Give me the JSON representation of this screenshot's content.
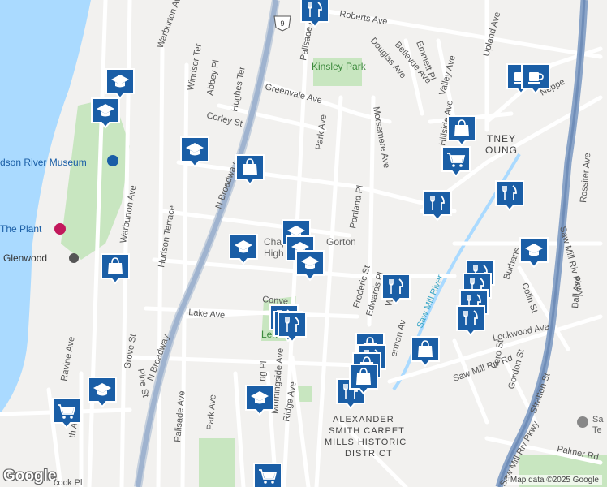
{
  "map": {
    "colors": {
      "water": "#aadaff",
      "land": "#f2f1ef",
      "park": "#c8e6c0",
      "highway": "#8aa4c8",
      "road": "#ffffff",
      "label": "#555555",
      "pin": "#1a5ea6",
      "park_label": "#3d8a3d",
      "river": "#aadaff"
    },
    "street_labels": [
      {
        "text": "Warburton Ave"
      },
      {
        "text": "Roberts Ave"
      },
      {
        "text": "Palisade Ave"
      },
      {
        "text": "Kinsley Park"
      },
      {
        "text": "Douglas Ave"
      },
      {
        "text": "Bellevue Ave"
      },
      {
        "text": "Emmett Pl"
      },
      {
        "text": "Valley Ave"
      },
      {
        "text": "Upland Ave"
      },
      {
        "text": "Windsor Ter"
      },
      {
        "text": "Abbey Pl"
      },
      {
        "text": "Hughes Ter"
      },
      {
        "text": "Greenvale Ave"
      },
      {
        "text": "Corley St"
      },
      {
        "text": "Park Ave"
      },
      {
        "text": "Morsemere Ave"
      },
      {
        "text": "Hillside Ave"
      },
      {
        "text": "Neppe"
      },
      {
        "text": "dson River Museum"
      },
      {
        "text": "N Broadway"
      },
      {
        "text": "Warburton Ave"
      },
      {
        "text": "Hudson Terrace"
      },
      {
        "text": "Portland Pl"
      },
      {
        "text": "The Plant"
      },
      {
        "text": "Glenwood"
      },
      {
        "text": "Chapel"
      },
      {
        "text": "Gorton"
      },
      {
        "text": "High"
      },
      {
        "text": "Frederic St"
      },
      {
        "text": "Saw Mill Riv Pkwy"
      },
      {
        "text": "Rossiter Ave"
      },
      {
        "text": "Burhans"
      },
      {
        "text": "Colin St"
      },
      {
        "text": "Ball Ave"
      },
      {
        "text": "Conve"
      },
      {
        "text": "Lake Ave"
      },
      {
        "text": "Lennon"
      },
      {
        "text": "Edwards Pl"
      },
      {
        "text": "Wood"
      },
      {
        "text": "Saw Mill River"
      },
      {
        "text": "Lockwood Ave"
      },
      {
        "text": "Ravine Ave"
      },
      {
        "text": "Grove St"
      },
      {
        "text": "Pine St"
      },
      {
        "text": "N Broadway"
      },
      {
        "text": "Palisade Ave"
      },
      {
        "text": "Park Ave"
      },
      {
        "text": "ng Pl"
      },
      {
        "text": "Morningside Ave"
      },
      {
        "text": "Ridge Ave"
      },
      {
        "text": "Saw Mill Riv Rd"
      },
      {
        "text": "Fero St"
      },
      {
        "text": "Gordon St"
      },
      {
        "text": "Stratton St"
      },
      {
        "text": "Saw Mill Riv Pkwy"
      },
      {
        "text": "Palmer Rd"
      },
      {
        "text": "ALEXANDER"
      },
      {
        "text": "SMITH CARPET"
      },
      {
        "text": "MILLS HISTORIC"
      },
      {
        "text": "DISTRICT"
      },
      {
        "text": "TNEY"
      },
      {
        "text": "OUNG"
      },
      {
        "text": "Sa"
      },
      {
        "text": "Te"
      },
      {
        "text": "th Ave"
      },
      {
        "text": "erman Av"
      },
      {
        "text": "cock Pl"
      }
    ],
    "route_shield": "9",
    "pins": [
      {
        "icon": "restaurant-icon"
      },
      {
        "icon": "school-icon"
      },
      {
        "icon": "school-icon"
      },
      {
        "icon": "cafe-icon"
      },
      {
        "icon": "cafe-icon"
      },
      {
        "icon": "shopping-bag-icon"
      },
      {
        "icon": "school-icon"
      },
      {
        "icon": "shopping-bag-icon"
      },
      {
        "icon": "shopping-cart-icon"
      },
      {
        "icon": "restaurant-icon"
      },
      {
        "icon": "restaurant-icon"
      },
      {
        "icon": "school-icon"
      },
      {
        "icon": "school-icon"
      },
      {
        "icon": "school-icon"
      },
      {
        "icon": "school-icon"
      },
      {
        "icon": "shopping-bag-icon"
      },
      {
        "icon": "school-icon"
      },
      {
        "icon": "restaurant-icon"
      },
      {
        "icon": "restaurant-icon"
      },
      {
        "icon": "restaurant-icon"
      },
      {
        "icon": "restaurant-icon"
      },
      {
        "icon": "restaurant-icon"
      },
      {
        "icon": "restaurant-icon"
      },
      {
        "icon": "restaurant-icon"
      },
      {
        "icon": "restaurant-icon"
      },
      {
        "icon": "shopping-bag-icon"
      },
      {
        "icon": "restaurant-icon"
      },
      {
        "icon": "shopping-bag-icon"
      },
      {
        "icon": "shopping-bag-icon"
      },
      {
        "icon": "restaurant-icon"
      },
      {
        "icon": "shopping-bag-icon"
      },
      {
        "icon": "school-icon"
      },
      {
        "icon": "school-icon"
      },
      {
        "icon": "shopping-cart-icon"
      },
      {
        "icon": "shopping-cart-icon"
      }
    ],
    "attribution": "Map data ©2025 Google",
    "logo": "Google"
  }
}
